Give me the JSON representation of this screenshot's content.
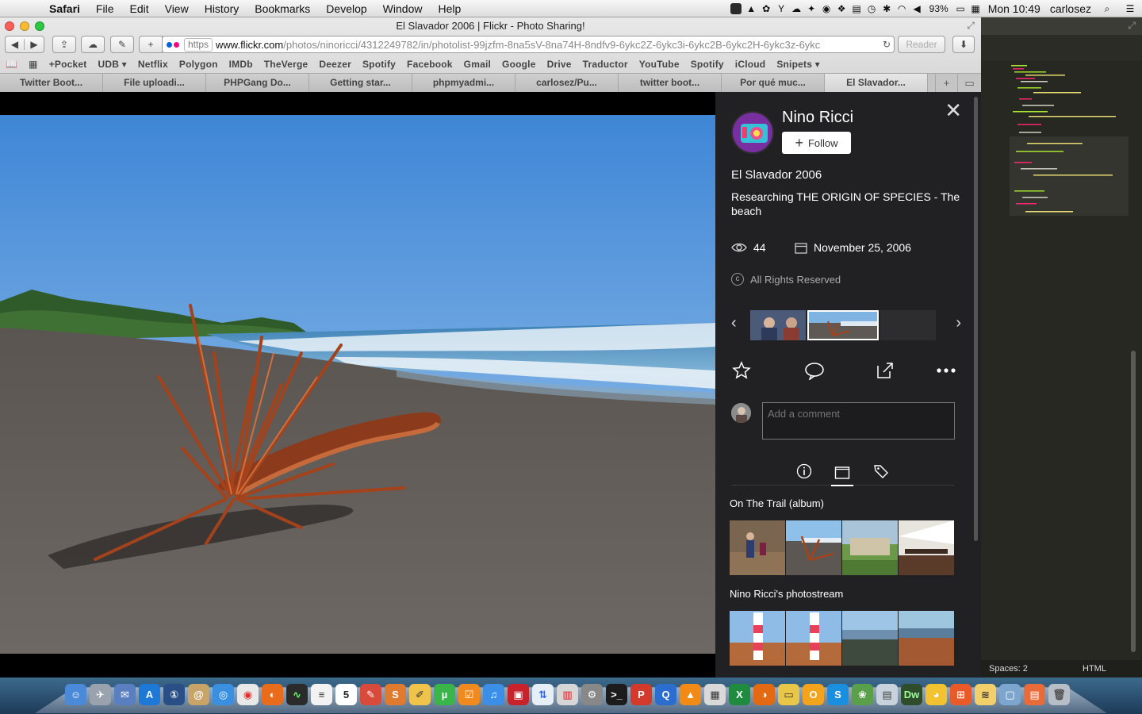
{
  "menubar": {
    "app": "Safari",
    "items": [
      "File",
      "Edit",
      "View",
      "History",
      "Bookmarks",
      "Develop",
      "Window",
      "Help"
    ],
    "battery": "93%",
    "clock": "Mon 10:49",
    "user": "carlosez"
  },
  "window": {
    "title": "El Slavador 2006 | Flickr - Photo Sharing!"
  },
  "toolbar": {
    "url_https": "https",
    "url_host": "www.flickr.com",
    "url_path": "/photos/ninoricci/4312249782/in/photolist-99jzfm-8na5sV-8na74H-8ndfv9-6ykc2Z-6ykc3i-6ykc2B-6ykc2H-6ykc3z-6ykc",
    "reader": "Reader"
  },
  "bookmarks": [
    "+Pocket",
    "UDB ▾",
    "Netflix",
    "Polygon",
    "IMDb",
    "TheVerge",
    "Deezer",
    "Spotify",
    "Facebook",
    "Gmail",
    "Google",
    "Drive",
    "Traductor",
    "YouTube",
    "Spotify",
    "iCloud",
    "Snipets ▾"
  ],
  "tabs": [
    "Twitter Boot...",
    "File uploadi...",
    "PHPGang Do...",
    "Getting star...",
    "phpmyadmi...",
    "carlosez/Pu...",
    "twitter boot...",
    "Por qué muc...",
    "El Slavador..."
  ],
  "panel": {
    "owner": "Nino Ricci",
    "follow_label": "Follow",
    "photo_title": "El Slavador 2006",
    "description": "Researching THE ORIGIN OF SPECIES - The beach",
    "views": "44",
    "date": "November 25, 2006",
    "license": "All Rights Reserved",
    "comment_placeholder": "Add a comment",
    "album_title": "On The Trail (album)",
    "photostream_title": "Nino Ricci's photostream"
  },
  "editor": {
    "spaces": "Spaces: 2",
    "syntax": "HTML"
  },
  "colors": {
    "panel_bg": "#212124",
    "flickr_blue": "#0063dc",
    "flickr_pink": "#ff0084"
  }
}
